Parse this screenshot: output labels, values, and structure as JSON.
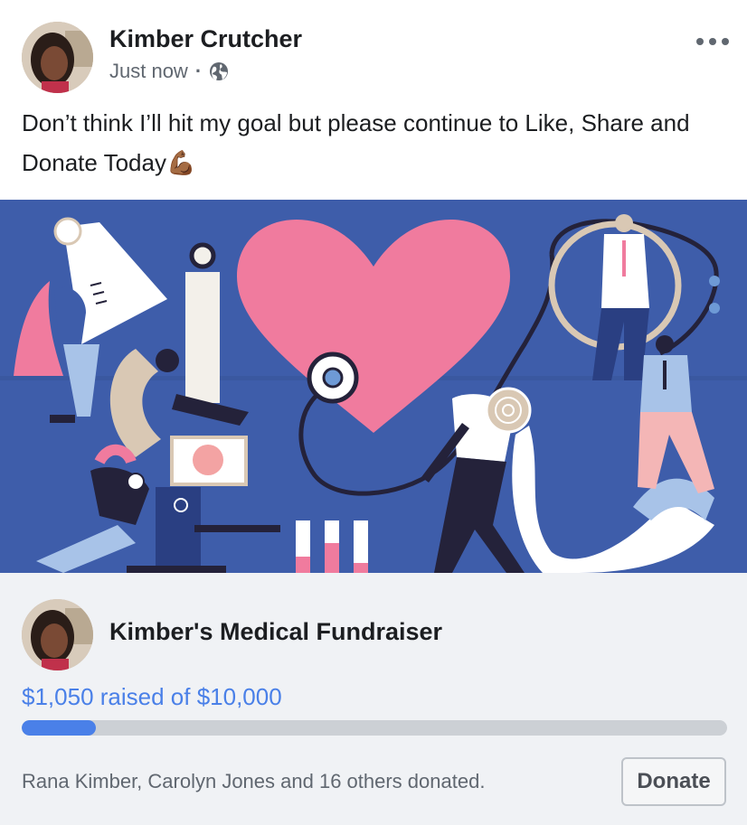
{
  "post": {
    "author": "Kimber Crutcher",
    "timestamp": "Just now",
    "separator": "·",
    "privacy_icon": "globe-icon",
    "more_icon": "more-options-icon",
    "text": "Don’t think I’ll hit my goal but please continue to Like, Share and Donate Today",
    "emoji": "💪🏾"
  },
  "fundraiser": {
    "title": "Kimber's Medical Fundraiser",
    "raised_text": "$1,050 raised of $10,000",
    "raised_amount": 1050,
    "goal_amount": 10000,
    "progress_fraction": 0.105,
    "donors_text": "Rana Kimber, Carolyn Jones and 16 others donated.",
    "donate_label": "Donate"
  },
  "colors": {
    "accent_blue": "#4a80e8",
    "hero_background": "#3e5daa",
    "heart_pink": "#f07b9e",
    "panel_background": "#f0f2f5"
  }
}
